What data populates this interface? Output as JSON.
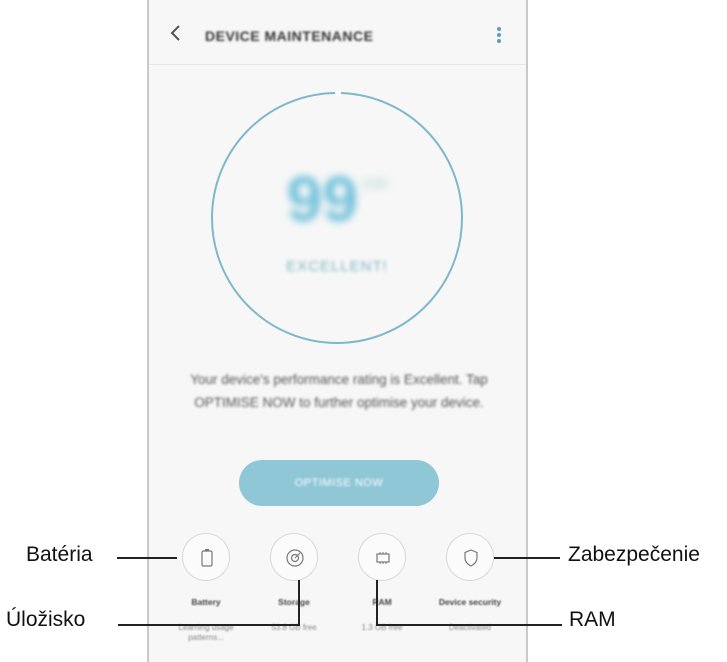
{
  "header": {
    "title": "DEVICE MAINTENANCE"
  },
  "score": {
    "value": "99",
    "unit": "/100",
    "status": "EXCELLENT!"
  },
  "description": "Your device's performance rating is Excellent. Tap OPTIMISE NOW to further optimise your device.",
  "optimise_label": "OPTIMISE NOW",
  "tiles": [
    {
      "label": "Battery",
      "sub": "Learning usage patterns..."
    },
    {
      "label": "Storage",
      "sub": "53.8 GB free"
    },
    {
      "label": "RAM",
      "sub": "1.3 GB free"
    },
    {
      "label": "Device security",
      "sub": "Deactivated"
    }
  ],
  "callouts": {
    "battery": "Batéria",
    "storage": "Úložisko",
    "ram": "RAM",
    "security": "Zabezpečenie"
  },
  "colors": {
    "accent": "#8fc7d6",
    "ring": "#7fb8c8"
  }
}
